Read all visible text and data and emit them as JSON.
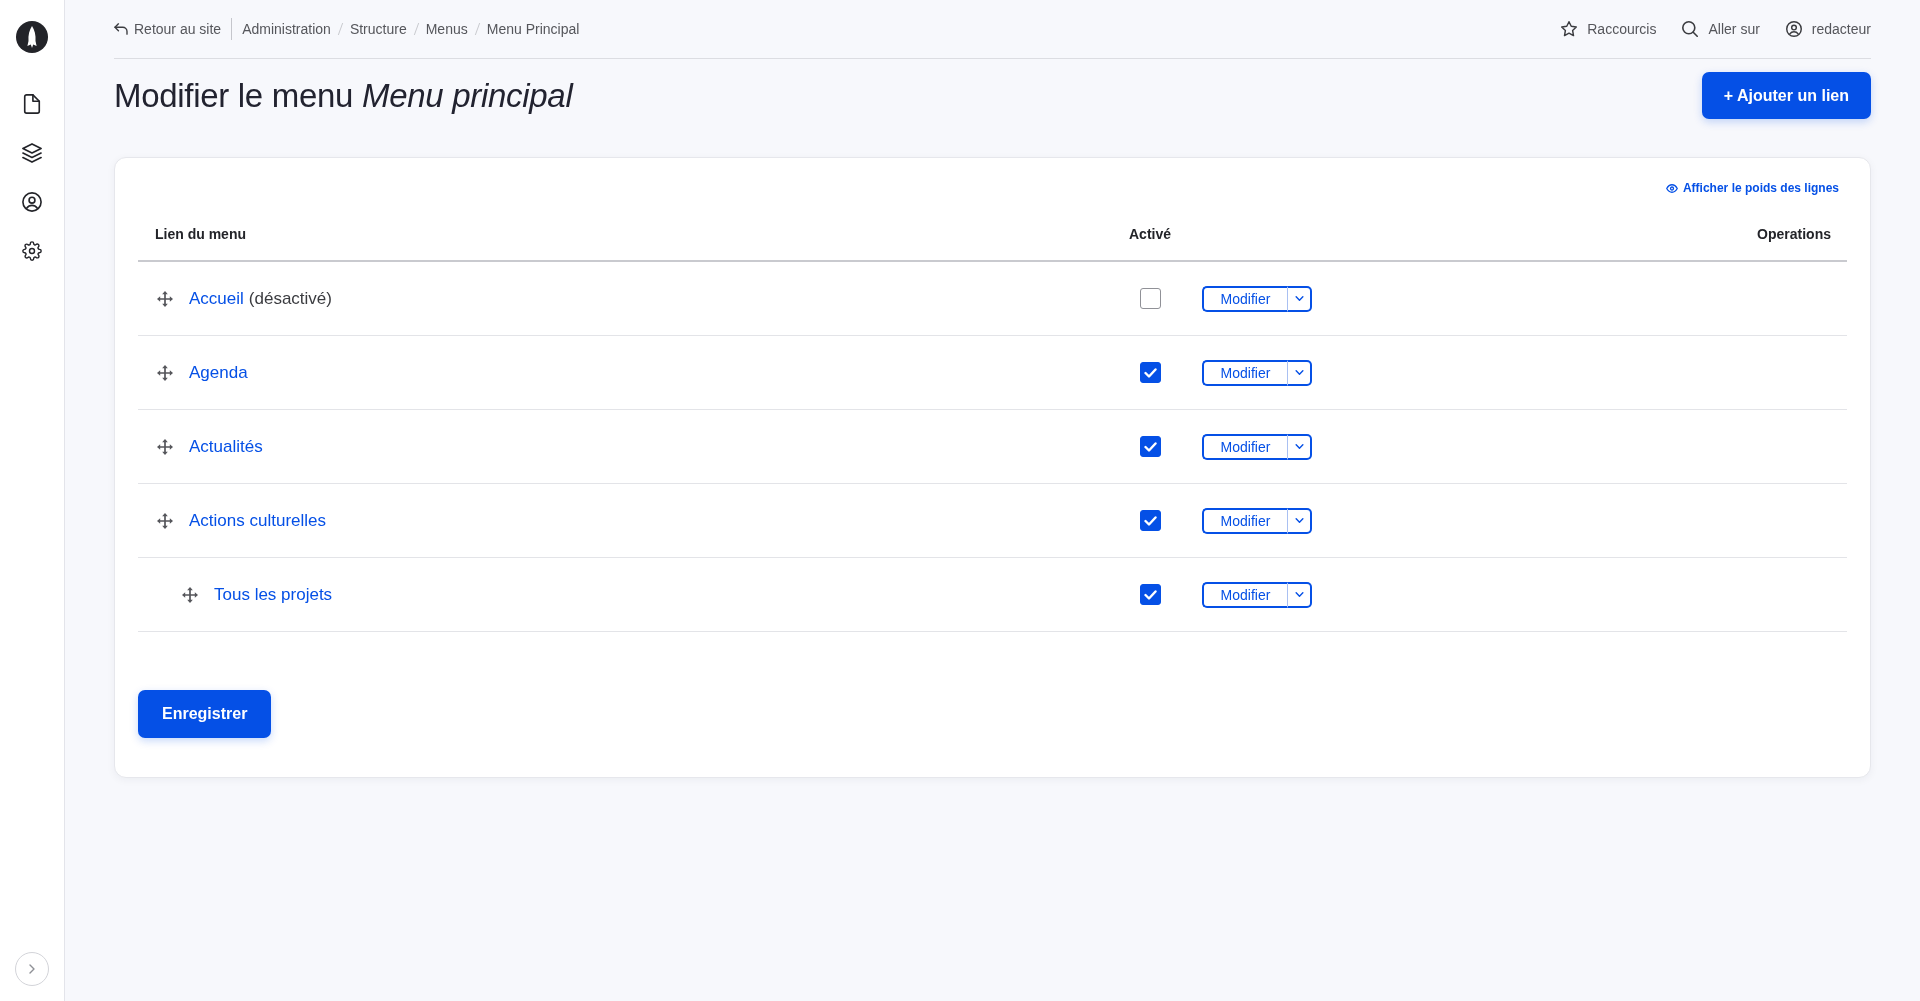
{
  "topbar": {
    "back_link": "Retour au site",
    "breadcrumb": [
      "Administration",
      "Structure",
      "Menus",
      "Menu Principal"
    ],
    "actions": [
      {
        "kind": "star",
        "label": "Raccourcis"
      },
      {
        "kind": "search",
        "label": "Aller sur"
      },
      {
        "kind": "user",
        "label": "redacteur"
      }
    ]
  },
  "page": {
    "title": "Modifier le menu *Menu principal*",
    "add_button": "+ Ajouter un lien"
  },
  "table": {
    "weights_toggle": "Afficher le poids des lignes",
    "columns": [
      "Lien du menu",
      "Activé",
      "Operations"
    ],
    "rows": [
      {
        "title": "Accueil",
        "note": "(désactivé)",
        "checked": false,
        "operation": "Modifier"
      },
      {
        "title": "Agenda",
        "checked": true,
        "operation": "Modifier"
      },
      {
        "title": "Actualités",
        "checked": true,
        "operation": "Modifier"
      },
      {
        "title": "Actions culturelles",
        "checked": true,
        "operation": "Modifier",
        "children": [
          {
            "title": "Tous les projets",
            "checked": true,
            "operation": "Modifier"
          }
        ]
      }
    ]
  },
  "save_button": "Enregistrer"
}
